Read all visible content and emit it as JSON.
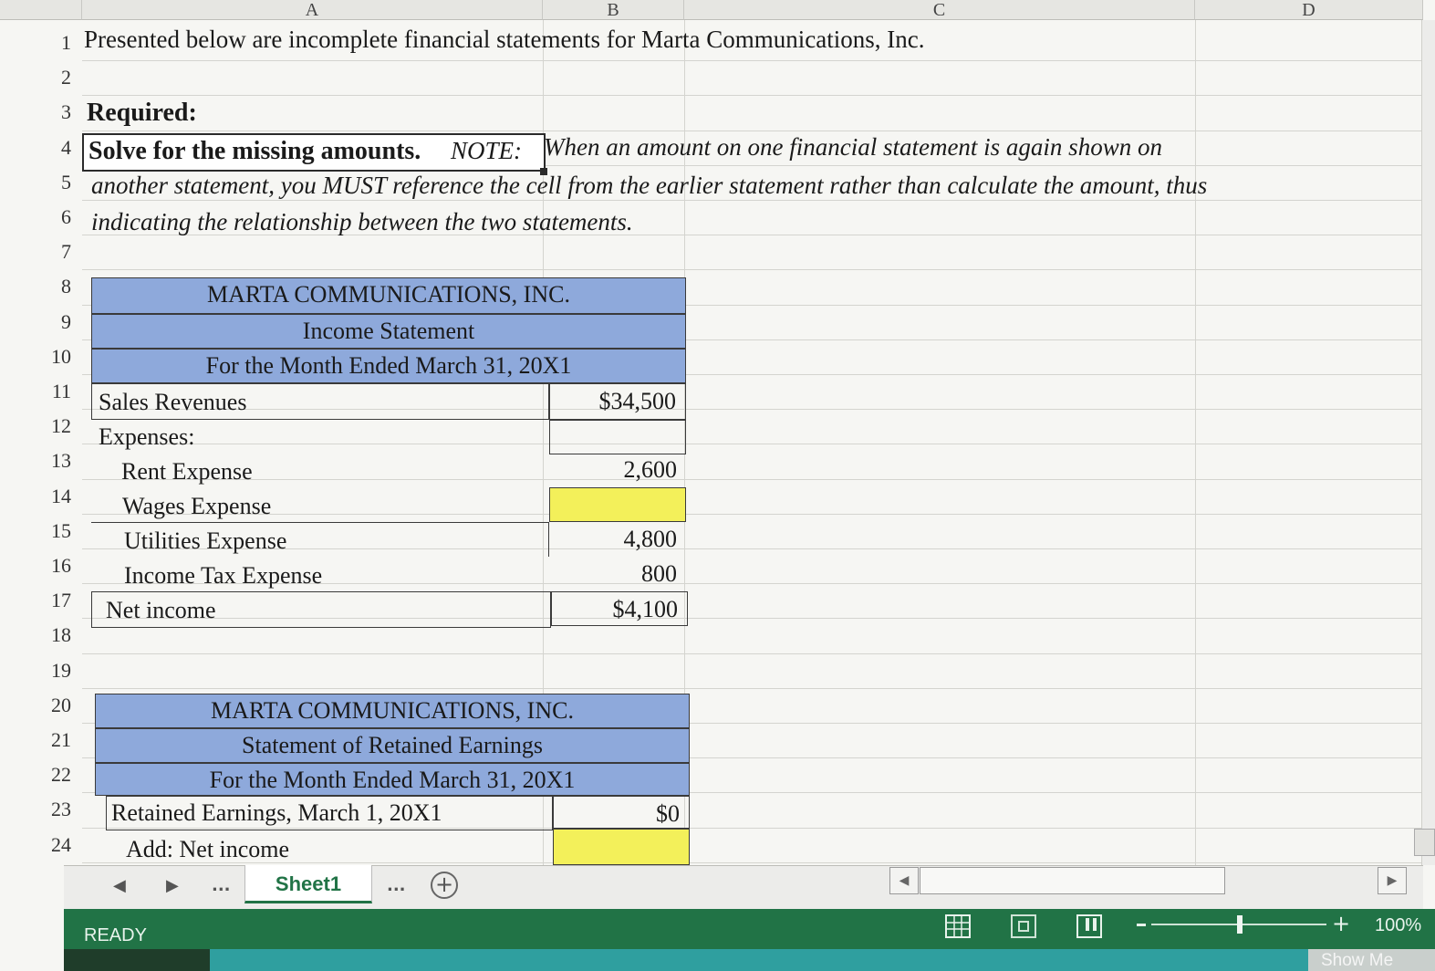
{
  "columns": [
    "A",
    "B",
    "C",
    "D"
  ],
  "rows": [
    "1",
    "2",
    "3",
    "4",
    "5",
    "6",
    "7",
    "8",
    "9",
    "10",
    "11",
    "12",
    "13",
    "14",
    "15",
    "16",
    "17",
    "18",
    "19",
    "20",
    "21",
    "22",
    "23",
    "24"
  ],
  "intro": {
    "line1": "Presented below are incomplete financial statements for Marta Communications, Inc.",
    "required": "Required:",
    "solve_bold": "Solve for the missing amounts.",
    "note_label": "NOTE:",
    "note_line1": "When an amount on one financial statement is again shown on",
    "note_line2": "another statement, you MUST reference the cell from the earlier statement rather than calculate the amount, thus",
    "note_line3": "indicating the relationship between the two statements."
  },
  "income_statement": {
    "company": "MARTA COMMUNICATIONS, INC.",
    "title": "Income Statement",
    "period": "For the Month Ended  March 31, 20X1",
    "rows": [
      {
        "label": "Sales Revenues",
        "amount": "$34,500"
      },
      {
        "label": "Expenses:",
        "amount": ""
      },
      {
        "label": "Rent Expense",
        "amount": "2,600"
      },
      {
        "label": "Wages Expense",
        "amount": ""
      },
      {
        "label": "Utilities Expense",
        "amount": "4,800"
      },
      {
        "label": "Income Tax Expense",
        "amount": "800"
      },
      {
        "label": "Net income",
        "amount": "$4,100"
      }
    ]
  },
  "retained_earnings": {
    "company": "MARTA COMMUNICATIONS, INC.",
    "title": "Statement of Retained Earnings",
    "period": "For the Month Ended  March 31, 20X1",
    "rows": [
      {
        "label": "Retained Earnings, March 1, 20X1",
        "amount": "$0"
      },
      {
        "label": "Add: Net income",
        "amount": ""
      }
    ]
  },
  "sheet_tabs": {
    "ellipsis_left": "...",
    "active": "Sheet1",
    "ellipsis_right": "..."
  },
  "status": {
    "mode": "READY",
    "zoom": "100%",
    "show_me": "Show Me"
  },
  "colors": {
    "header_band": "#8ea9db",
    "missing_cell": "#f3f05a",
    "status_bar": "#217346"
  }
}
